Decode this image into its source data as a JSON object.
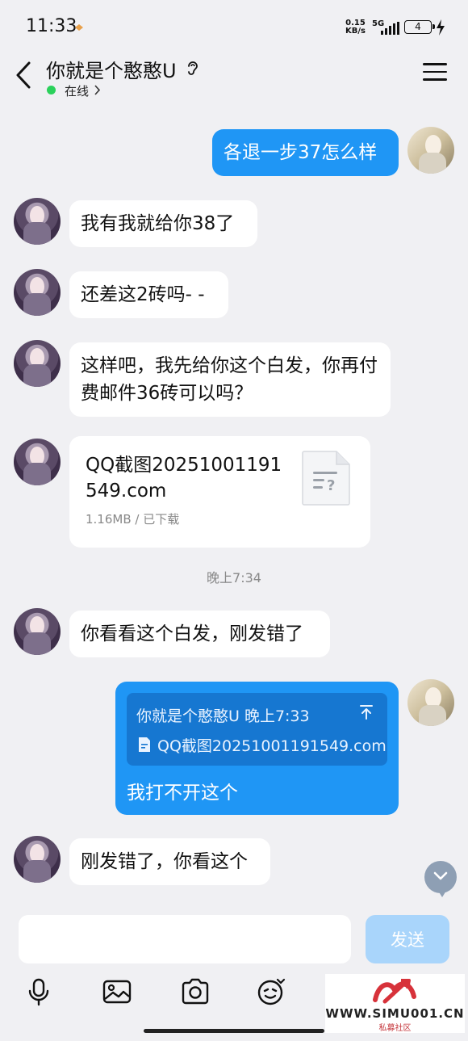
{
  "status": {
    "time": "11:33",
    "net_speed_value": "0.15",
    "net_speed_unit": "KB/s",
    "network": "5G",
    "battery": "4"
  },
  "header": {
    "title": "你就是个憨憨U",
    "status": "在线"
  },
  "messages": [
    {
      "dir": "out",
      "text": "各退一步37怎么样"
    },
    {
      "dir": "in",
      "text": "我有我就给你38了"
    },
    {
      "dir": "in",
      "text": "还差这2砖吗- -"
    },
    {
      "dir": "in",
      "text": "这样吧，我先给你这个白发，你再付费邮件36砖可以吗？"
    },
    {
      "dir": "in",
      "type": "file",
      "file_name": "QQ截图20251001191549.com",
      "file_meta": "1.16MB / 已下载"
    },
    {
      "dir": "in",
      "text": "你看看这个白发，刚发错了"
    },
    {
      "dir": "out",
      "type": "reply",
      "quote_author": "你就是个憨憨U 晚上7:33",
      "quote_file": "QQ截图20251001191549.com",
      "text": "我打不开这个"
    },
    {
      "dir": "in",
      "text": "刚发错了，你看这个"
    }
  ],
  "timestamp": "晚上7:34",
  "composer": {
    "placeholder": "",
    "send_label": "发送"
  },
  "toolbar": [
    "microphone-icon",
    "image-icon",
    "camera-icon",
    "sticker-icon"
  ],
  "watermark": {
    "text": "WWW.SIMU001.CN",
    "sub": "私募社区"
  },
  "colors": {
    "outgoing_bubble": "#1f96f5",
    "incoming_bubble": "#ffffff",
    "background": "#f0f0f3",
    "online": "#2bd15b",
    "send_button": "#a9d5fb"
  }
}
